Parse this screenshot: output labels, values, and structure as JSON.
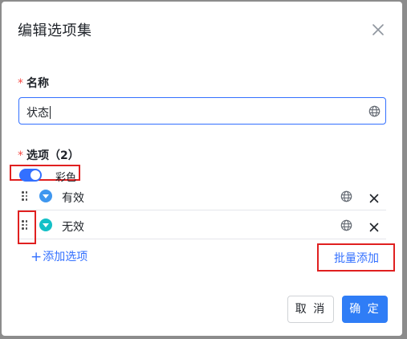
{
  "dialog": {
    "title": "编辑选项集",
    "close_icon": "close-icon"
  },
  "name_field": {
    "required_mark": "*",
    "label": "名称",
    "value": "状态",
    "icon": "globe-icon"
  },
  "options_field": {
    "required_mark": "*",
    "label": "选项（2）",
    "color_toggle": {
      "label": "彩色",
      "enabled": true
    },
    "items": [
      {
        "label": "有效",
        "color": "#3f97ef",
        "icons": [
          "drag-handle-icon",
          "caret-down-icon",
          "globe-icon",
          "close-icon"
        ]
      },
      {
        "label": "无效",
        "color": "#14c0c7",
        "icons": [
          "drag-handle-icon",
          "caret-down-icon",
          "globe-icon",
          "close-icon"
        ]
      }
    ],
    "add_option": {
      "plus": "+",
      "label": "添加选项"
    },
    "batch_add": "批量添加"
  },
  "footer": {
    "cancel": "取 消",
    "ok": "确 定"
  },
  "colors": {
    "accent": "#3370ff",
    "primary_button": "#2f7df6",
    "required": "#f54a45",
    "highlight_box": "#e02020"
  }
}
